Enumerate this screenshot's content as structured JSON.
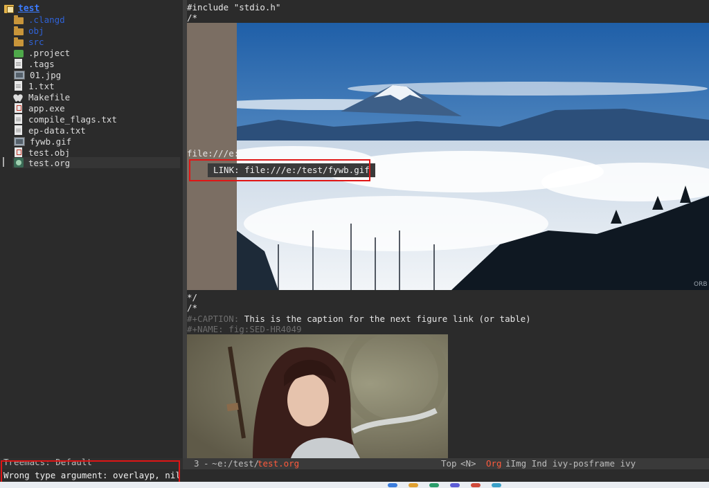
{
  "treemacs": {
    "root_label": "test",
    "items": [
      {
        "name": ".clangd",
        "kind": "dir",
        "icon": "folder-icon"
      },
      {
        "name": "obj",
        "kind": "dir",
        "icon": "folder-icon"
      },
      {
        "name": "src",
        "kind": "dir",
        "icon": "folder-icon"
      },
      {
        "name": ".project",
        "kind": "file",
        "icon": "project-icon"
      },
      {
        "name": ".tags",
        "kind": "file",
        "icon": "text-file-icon"
      },
      {
        "name": "01.jpg",
        "kind": "file",
        "icon": "image-file-icon"
      },
      {
        "name": "1.txt",
        "kind": "file",
        "icon": "text-file-icon"
      },
      {
        "name": "Makefile",
        "kind": "file",
        "icon": "makefile-icon"
      },
      {
        "name": "app.exe",
        "kind": "file",
        "icon": "exe-file-icon"
      },
      {
        "name": "compile_flags.txt",
        "kind": "file",
        "icon": "text-file-icon"
      },
      {
        "name": "ep-data.txt",
        "kind": "file",
        "icon": "text-file-icon"
      },
      {
        "name": "fywb.gif",
        "kind": "file",
        "icon": "image-file-icon"
      },
      {
        "name": "test.obj",
        "kind": "file",
        "icon": "exe-file-icon"
      },
      {
        "name": "test.org",
        "kind": "file",
        "icon": "org-file-icon",
        "selected": true
      }
    ],
    "mode_line": "Treemacs: Default"
  },
  "editor": {
    "line_include": "#include \"stdio.h\"",
    "line_comment_open": "/*",
    "line_file_prefix": "file:///e:",
    "tooltip": "LINK: file:///e:/test/fywb.gif",
    "line_comment_close": "*/",
    "line_comment_open2": "/*",
    "caption_keyword": "#+CAPTION:",
    "caption_text": " This is the caption for the next figure link (or table)",
    "name_keyword": "#+NAME:",
    "name_value": "   fig:SED-HR4049",
    "watermark": "ORB"
  },
  "modeline": {
    "line_number": "3",
    "separator": "-",
    "marker": "~",
    "path": "e:/test/",
    "filename": "test.org",
    "position": "Top",
    "state": "<N>",
    "major_mode": "Org",
    "minor_modes": "iImg Ind ivy-posframe ivy"
  },
  "echo": {
    "message": "Wrong type argument: overlayp, nil"
  },
  "colors": {
    "highlight_box": "#e01515",
    "org_mode": "#ff5a3c",
    "tree_root": "#3c7cff",
    "dir_label": "#2f62d6"
  }
}
